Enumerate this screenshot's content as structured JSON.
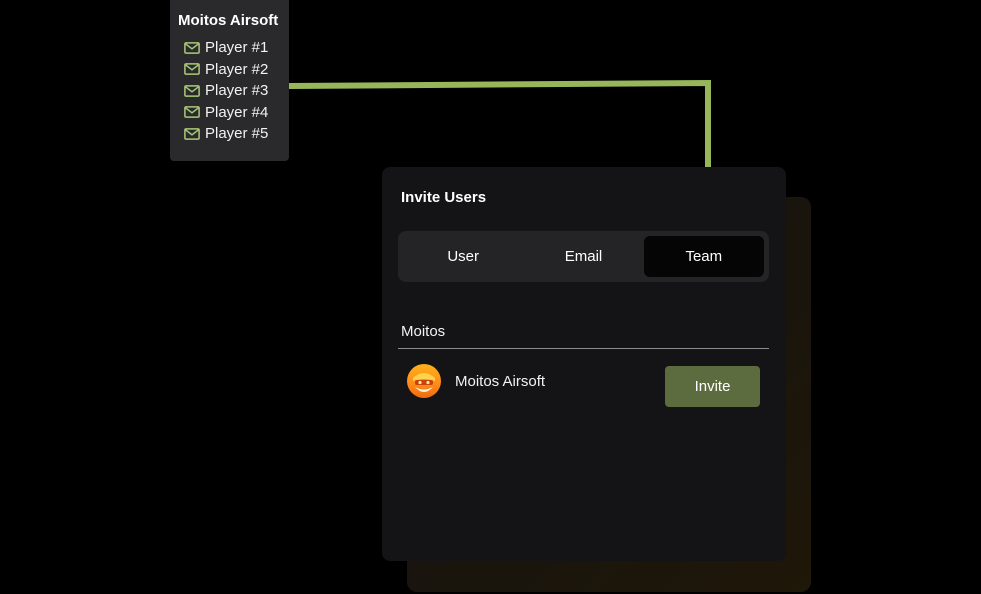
{
  "team_card": {
    "title": "Moitos Airsoft",
    "players": [
      {
        "label": "Player #1",
        "icon": "mail-icon"
      },
      {
        "label": "Player #2",
        "icon": "mail-icon"
      },
      {
        "label": "Player #3",
        "icon": "mail-icon"
      },
      {
        "label": "Player #4",
        "icon": "mail-icon"
      },
      {
        "label": "Player #5",
        "icon": "mail-icon"
      }
    ]
  },
  "invite_panel": {
    "title": "Invite Users",
    "tabs": [
      {
        "label": "User",
        "active": false
      },
      {
        "label": "Email",
        "active": false
      },
      {
        "label": "Team",
        "active": true
      }
    ],
    "search": {
      "value": "Moitos",
      "placeholder": ""
    },
    "results": [
      {
        "name": "Moitos Airsoft",
        "avatar": "team-logo-avatar",
        "action_label": "Invite"
      }
    ]
  },
  "colors": {
    "background": "#000000",
    "panel": "#141416",
    "team_card": "#2a2a2c",
    "accent_line": "#97b65a",
    "mail_icon": "#a9c978",
    "invite_button": "#5c6c3f",
    "active_tab": "#050505"
  }
}
